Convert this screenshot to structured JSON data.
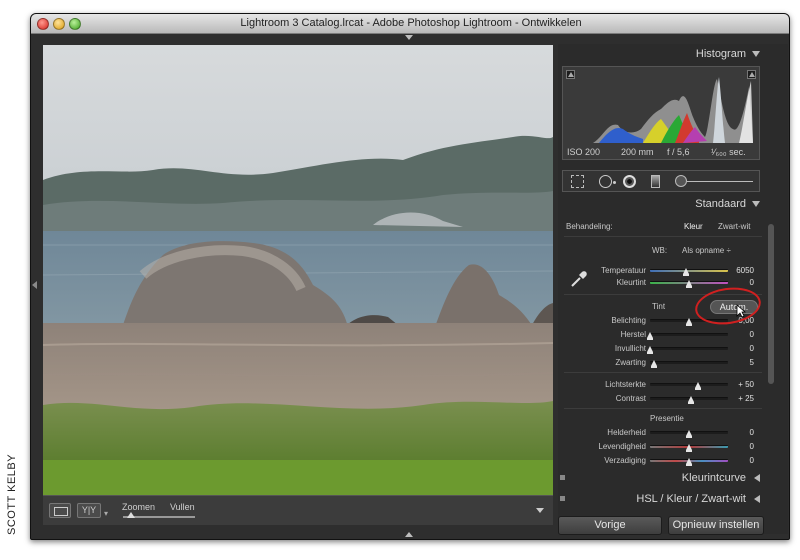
{
  "window": {
    "title": "Lightroom 3 Catalog.lrcat - Adobe Photoshop Lightroom - Ontwikkelen"
  },
  "credit": "SCOTT KELBY",
  "toolbar": {
    "yy_label": "Y|Y",
    "zoom_label": "Zoomen",
    "fill_label": "Vullen"
  },
  "panel": {
    "histogram": {
      "header": "Histogram",
      "iso": "ISO 200",
      "focal": "200 mm",
      "aperture": "f / 5,6",
      "shutter": "¹⁄₆₀₀ sec."
    },
    "standard": {
      "header": "Standaard",
      "treatment_label": "Behandeling:",
      "treatment_color": "Kleur",
      "treatment_bw": "Zwart-wit",
      "wb_label": "WB:",
      "wb_value": "Als opname ÷",
      "temperature": {
        "label": "Temperatuur",
        "value": "6050",
        "level": 0.46
      },
      "tint": {
        "label": "Kleurtint",
        "value": "0",
        "level": 0.5
      },
      "tone_label": "Tint",
      "auto_label": "Autom.",
      "exposure": {
        "label": "Belichting",
        "value": "0,00",
        "level": 0.5
      },
      "recovery": {
        "label": "Herstel",
        "value": "0",
        "level": 0.0
      },
      "fill_light": {
        "label": "Invullicht",
        "value": "0",
        "level": 0.0
      },
      "blacks": {
        "label": "Zwarting",
        "value": "5",
        "level": 0.05
      },
      "brightness": {
        "label": "Lichtsterkte",
        "value": "+ 50",
        "level": 0.62
      },
      "contrast": {
        "label": "Contrast",
        "value": "+ 25",
        "level": 0.52
      },
      "presence_label": "Presentie",
      "clarity": {
        "label": "Helderheid",
        "value": "0",
        "level": 0.5
      },
      "vibrance": {
        "label": "Levendigheid",
        "value": "0",
        "level": 0.5
      },
      "saturation": {
        "label": "Verzadiging",
        "value": "0",
        "level": 0.5
      }
    },
    "tone_curve": {
      "header": "Kleurintcurve"
    },
    "hsl": {
      "header": "HSL / Kleur / Zwart-wit"
    },
    "buttons": {
      "previous": "Vorige",
      "reset": "Opnieuw instellen"
    }
  },
  "colors": {
    "annotation_ellipse": "#d02020",
    "panel_bg": "#2b2b2b"
  }
}
